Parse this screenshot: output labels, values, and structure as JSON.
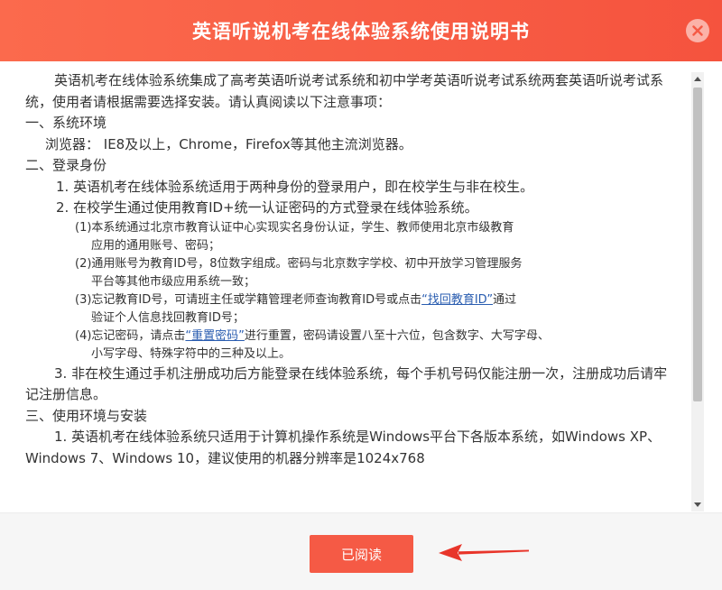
{
  "dialog": {
    "title": "英语听说机考在线体验系统使用说明书",
    "read_button_label": "已阅读"
  },
  "colors": {
    "header": "#f55a45",
    "button": "#f55a45",
    "link": "#2a5db0",
    "annotation_arrow": "#e8352a"
  },
  "icons": {
    "close": "close-icon",
    "scroll_up": "scroll-up-arrow-icon",
    "scroll_down": "scroll-down-arrow-icon",
    "annotation": "red-arrow-icon"
  },
  "doc": {
    "intro": "英语机考在线体验系统集成了高考英语听说考试系统和初中学考英语听说考试系统两套英语听说考试系统，使用者请根据需要选择安装。请认真阅读以下注意事项：",
    "s1_title": "一、系统环境",
    "s1_browser": "浏览器：  IE8及以上，Chrome，Firefox等其他主流浏览器。",
    "s2_title": "二、登录身份",
    "s2_p1": "1. 英语机考在线体验系统适用于两种身份的登录用户，即在校学生与非在校生。",
    "s2_p2": "2. 在校学生通过使用教育ID+统一认证密码的方式登录在线体验系统。",
    "s2_n1_a": "(1)本系统通过北京市教育认证中心实现实名身份认证，学生、教师使用北京市级教育",
    "s2_n1_b": "应用的通用账号、密码；",
    "s2_n2_a": "(2)通用账号为教育ID号，8位数字组成。密码与北京数字学校、初中开放学习管理服务",
    "s2_n2_b": "平台等其他市级应用系统一致；",
    "s2_n3_pre": "(3)忘记教育ID号，可请班主任或学籍管理老师查询教育ID号或点击",
    "s2_n3_link": "“找回教育ID”",
    "s2_n3_post": "通过",
    "s2_n3_b": "验证个人信息找回教育ID号；",
    "s2_n4_pre": "(4)忘记密码，请点击",
    "s2_n4_link": "“重置密码”",
    "s2_n4_post": "进行重置，密码请设置八至十六位，包含数字、大写字母、",
    "s2_n4_b": "小写字母、特殊字符中的三种及以上。",
    "s2_p3": "3. 非在校生通过手机注册成功后方能登录在线体验系统，每个手机号码仅能注册一次，注册成功后请牢记注册信息。",
    "s3_title": "三、使用环境与安装",
    "s3_p1": "1. 英语机考在线体验系统只适用于计算机操作系统是Windows平台下各版本系统，如Windows XP、Windows 7、Windows 10，建议使用的机器分辨率是1024x768"
  }
}
